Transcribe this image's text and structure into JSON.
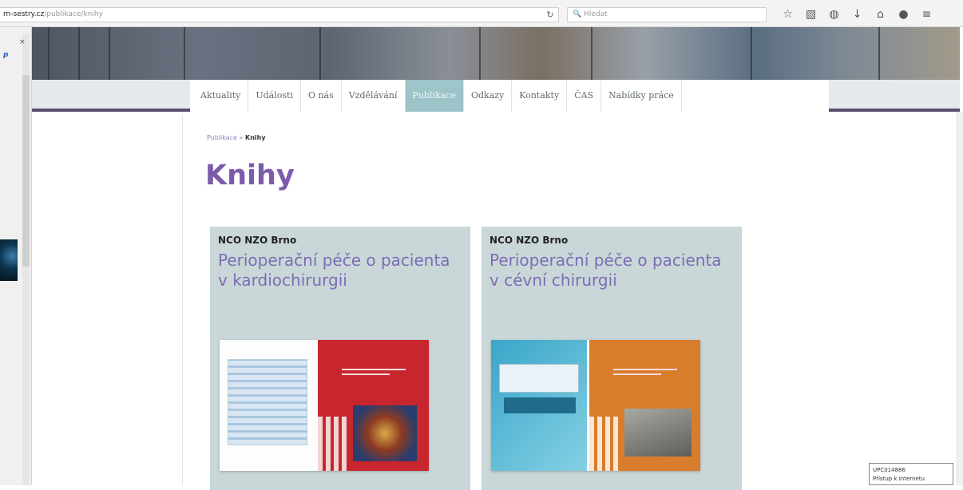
{
  "browser": {
    "url_host": "rn-sestry.cz",
    "url_path": "/publikace/knihy",
    "search_placeholder": "Hledat",
    "reload_icon": "reload-icon",
    "toolbar_icons": [
      "bookmark-star-icon",
      "clipboard-icon",
      "pocket-icon",
      "download-icon",
      "home-icon",
      "chat-icon",
      "menu-icon"
    ]
  },
  "nav": {
    "items": [
      {
        "label": "Aktuality"
      },
      {
        "label": "Události"
      },
      {
        "label": "O nás"
      },
      {
        "label": "Vzdělávání"
      },
      {
        "label": "Publikace"
      },
      {
        "label": "Odkazy"
      },
      {
        "label": "Kontakty"
      },
      {
        "label": "ČAS"
      },
      {
        "label": "Nabídky práce"
      }
    ],
    "active": "Publikace"
  },
  "breadcrumb": {
    "parent": "Publikace",
    "separator": "»",
    "current": "Knihy"
  },
  "page": {
    "title": "Knihy"
  },
  "books": [
    {
      "publisher": "NCO NZO Brno",
      "title": "Perioperační péče o pacienta v kardiochirurgii"
    },
    {
      "publisher": "NCO NZO Brno",
      "title": "Perioperační péče o pacienta v cévní chirurgii"
    }
  ],
  "tooltip": {
    "line1": "UPC014886",
    "line2": "Přístup k Internetu"
  },
  "colors": {
    "accent": "#7d5bab",
    "nav_active": "#9cc4c9",
    "card_bg": "#c9d7d9",
    "nav_border": "#5b4d6f"
  }
}
